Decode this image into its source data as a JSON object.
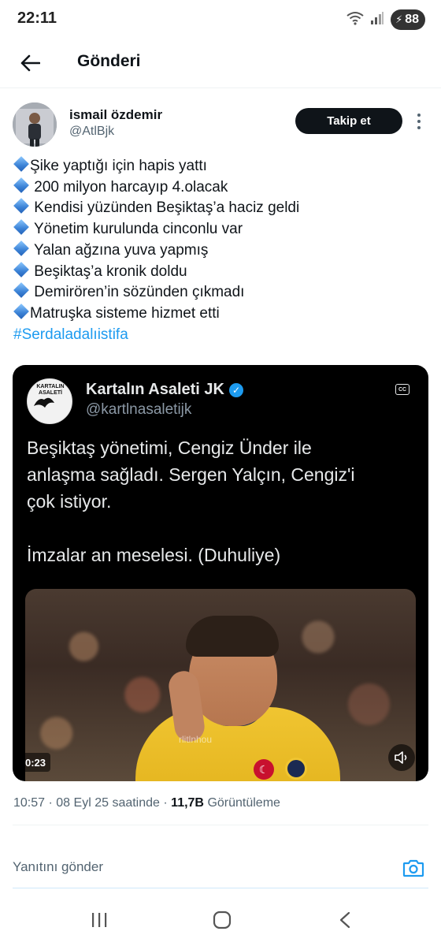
{
  "status_bar": {
    "time": "22:11",
    "battery": "88",
    "icons": [
      "wifi-icon",
      "signal-icon",
      "battery-icon"
    ]
  },
  "header": {
    "title": "Gönderi",
    "back_icon": "back-arrow-icon"
  },
  "author": {
    "name": "ismail özdemir",
    "handle": "@AtlBjk",
    "follow_label": "Takip et"
  },
  "tweet": {
    "lines": [
      {
        "text": "Şike yaptığı için hapis yattı",
        "spaced": false
      },
      {
        "text": "200 milyon harcayıp 4.olacak",
        "spaced": true
      },
      {
        "text": "Kendisi yüzünden Beşiktaş’a haciz geldi",
        "spaced": true
      },
      {
        "text": "Yönetim kurulunda cinconlu var",
        "spaced": true
      },
      {
        "text": "Yalan ağzına yuva yapmış",
        "spaced": true
      },
      {
        "text": "Beşiktaş’a kronik doldu",
        "spaced": true
      },
      {
        "text": "Demirören’in sözünden çıkmadı",
        "spaced": true
      },
      {
        "text": "Matruşka sisteme hizmet etti",
        "spaced": false
      }
    ],
    "hashtag": "#Serdaladalıistifa"
  },
  "media": {
    "source_name": "Kartalın Asaleti JK",
    "source_handle": "@kartlnasaletijk",
    "source_logo_text": "KARTALIN ASALETİ",
    "cc_label": "CC",
    "text_line1": "Beşiktaş yönetimi, Cengiz Ünder ile",
    "text_line2": "anlaşma sağladı. Sergen Yalçın, Cengiz'i",
    "text_line3": "çok istiyor.",
    "text_line4": "İmzalar an meselesi. (Duhuliye)",
    "duration": "0:23",
    "watermark": "rlitlnhou"
  },
  "meta": {
    "time": "10:57",
    "date": "08 Eyl 25 saatinde",
    "views": "11,7B",
    "views_label": "Görüntüleme"
  },
  "reply": {
    "placeholder": "Yanıtını gönder"
  },
  "colors": {
    "link": "#1d9bf0",
    "text": "#0f1419",
    "secondary": "#536471",
    "button_bg": "#0f1419"
  }
}
